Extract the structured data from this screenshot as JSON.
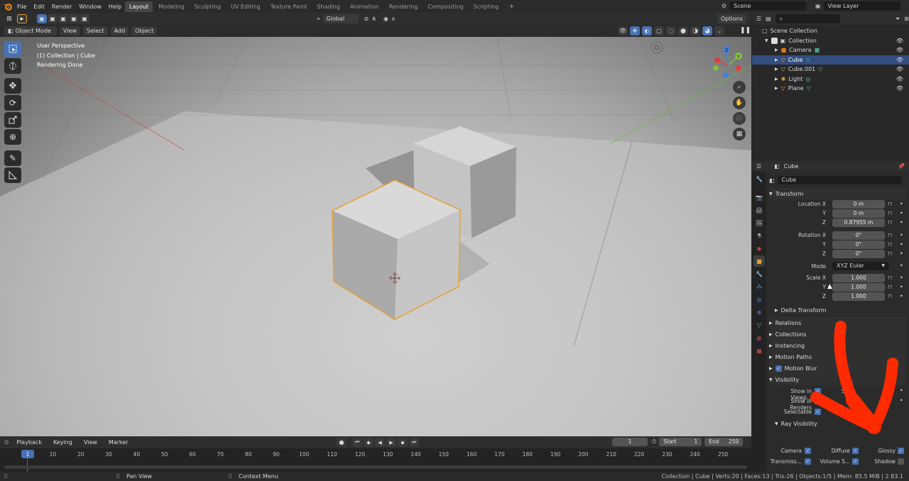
{
  "topbar": {
    "menu": [
      "File",
      "Edit",
      "Render",
      "Window",
      "Help"
    ],
    "workspaces": [
      "Layout",
      "Modeling",
      "Sculpting",
      "UV Editing",
      "Texture Paint",
      "Shading",
      "Animation",
      "Rendering",
      "Compositing",
      "Scripting"
    ],
    "add_tab": "+",
    "scene": "Scene",
    "view_layer": "View Layer"
  },
  "header": {
    "orientation": "Global",
    "options": "Options"
  },
  "viewport_header": {
    "mode": "Object Mode",
    "menus": [
      "View",
      "Select",
      "Add",
      "Object"
    ]
  },
  "viewport": {
    "info": [
      "User Perspective",
      "(1) Collection | Cube",
      "Rendering Done"
    ]
  },
  "outliner": {
    "root": "Scene Collection",
    "collection": "Collection",
    "items": [
      {
        "name": "Camera",
        "selected": false
      },
      {
        "name": "Cube",
        "selected": true
      },
      {
        "name": "Cube.001",
        "selected": false
      },
      {
        "name": "Light",
        "selected": false
      },
      {
        "name": "Plane",
        "selected": false
      }
    ]
  },
  "properties": {
    "object_header": "Cube",
    "object_name": "Cube",
    "transform": {
      "title": "Transform",
      "location_label": "Location X",
      "location": [
        "0 m",
        "0 m",
        "0.87955 m"
      ],
      "rotation_label": "Rotation X",
      "rotation": [
        "0°",
        "0°",
        "0°"
      ],
      "mode_label": "Mode",
      "mode": "XYZ Euler",
      "scale_label": "Scale X",
      "scale": [
        "1.000",
        "1.000",
        "1.000"
      ],
      "axis_y": "Y",
      "axis_z": "Z",
      "delta": "Delta Transform"
    },
    "panels": [
      "Relations",
      "Collections",
      "Instancing",
      "Motion Paths",
      "Motion Blur"
    ],
    "visibility": {
      "title": "Visibility",
      "show_viewport": "Show in Viewp...",
      "shadow_partial": "Shad",
      "show_renders": "Show in Renders",
      "selectable": "Selectable",
      "ray_title": "Ray Visibility",
      "camera": "Camera",
      "diffuse": "Diffuse",
      "glossy": "Glossy",
      "transmission": "Transmiss...",
      "volume": "Volume S...",
      "shadow": "Shadow"
    }
  },
  "timeline": {
    "menus": [
      "Playback",
      "Keying",
      "View",
      "Marker"
    ],
    "current_frame": "1",
    "start_label": "Start",
    "start": "1",
    "end_label": "End",
    "end": "250",
    "ticks": [
      "1",
      "10",
      "20",
      "30",
      "40",
      "50",
      "60",
      "70",
      "80",
      "90",
      "100",
      "110",
      "120",
      "130",
      "140",
      "150",
      "160",
      "170",
      "180",
      "190",
      "200",
      "210",
      "220",
      "230",
      "240",
      "250"
    ]
  },
  "statusbar": {
    "pan": "Pan View",
    "context": "Context Menu",
    "stats": "Collection | Cube | Verts:20 | Faces:13 | Tris:26 | Objects:1/5 | Mem: 85.5 MiB | 2.83.1"
  },
  "colors": {
    "accent": "#4772b3",
    "annotation": "#ff2a00",
    "selection_outline": "#e8a030"
  }
}
